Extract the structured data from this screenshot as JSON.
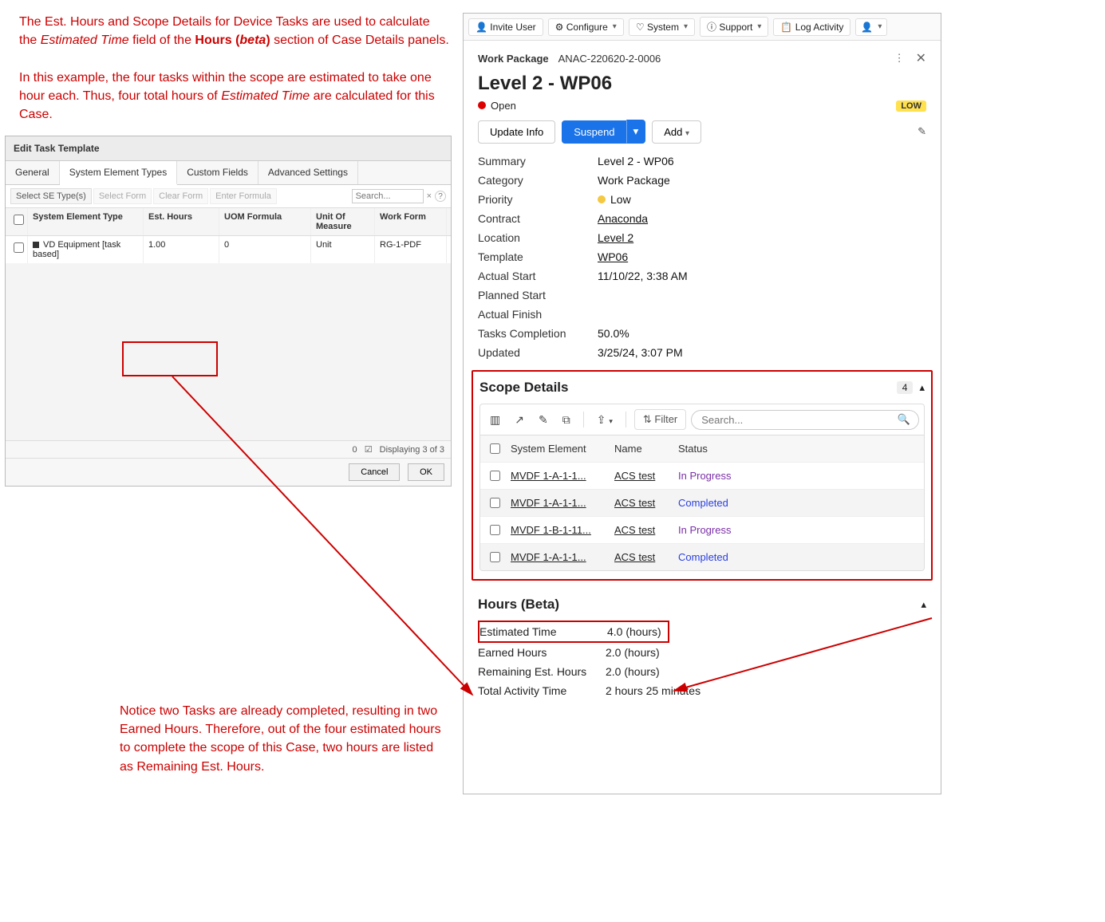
{
  "annotations": {
    "top": "The Est. Hours and Scope Details for Device Tasks are used to calculate the <em>Estimated Time</em> field of the <b>Hours (<em>beta</em>)</b> section of Case Details panels.<br><br>In this example, the four tasks within the scope are estimated to take one hour each. Thus, four total hours of <em>Estimated Time</em> are calculated for this Case.",
    "bottom": "Notice two Tasks are already completed, resulting in two Earned Hours. Therefore, out of the four estimated hours to complete the scope of this Case, two hours are listed as Remaining Est. Hours."
  },
  "editPanel": {
    "title": "Edit Task Template",
    "tabs": [
      "General",
      "System Element Types",
      "Custom Fields",
      "Advanced Settings"
    ],
    "activeTab": 1,
    "toolbar": {
      "select": "Select SE Type(s)",
      "selectForm": "Select Form",
      "clearForm": "Clear Form",
      "enterFormula": "Enter Formula",
      "searchPH": "Search...",
      "clear": "×",
      "help": "?"
    },
    "columns": {
      "set": "System Element Type",
      "est": "Est. Hours",
      "uomf": "UOM Formula",
      "um": "Unit Of Measure",
      "wf": "Work Form"
    },
    "rows": [
      {
        "set": "VD Equipment [task based]",
        "est": "1.00",
        "uomf": "0",
        "um": "Unit",
        "wf": "RG-1-PDF"
      }
    ],
    "footer": {
      "count": "0",
      "check": "☑",
      "display": "Displaying 3 of 3",
      "cancel": "Cancel",
      "ok": "OK"
    }
  },
  "topbar": {
    "invite": "Invite User",
    "configure": "Configure",
    "system": "System",
    "support": "Support",
    "log": "Log Activity"
  },
  "wp": {
    "breadcrumbLabel": "Work Package",
    "breadcrumbId": "ANAC-220620-2-0006",
    "title": "Level 2 - WP06",
    "status": "Open",
    "priorityBadge": "LOW",
    "actions": {
      "update": "Update Info",
      "suspend": "Suspend",
      "add": "Add"
    },
    "fields": [
      {
        "k": "Summary",
        "v": "Level 2 - WP06"
      },
      {
        "k": "Category",
        "v": "Work Package"
      },
      {
        "k": "Priority",
        "v": "Low",
        "dot": true
      },
      {
        "k": "Contract",
        "v": "Anaconda",
        "link": true
      },
      {
        "k": "Location",
        "v": "Level 2",
        "link": true
      },
      {
        "k": "Template",
        "v": "WP06",
        "link": true
      },
      {
        "k": "Actual Start",
        "v": "11/10/22, 3:38 AM"
      },
      {
        "k": "Planned Start",
        "v": ""
      },
      {
        "k": "Actual Finish",
        "v": ""
      },
      {
        "k": "Tasks Completion",
        "v": "50.0%"
      },
      {
        "k": "Updated",
        "v": "3/25/24, 3:07 PM"
      }
    ]
  },
  "scope": {
    "title": "Scope Details",
    "count": "4",
    "filterLabel": "Filter",
    "searchPH": "Search...",
    "columns": {
      "se": "System Element",
      "name": "Name",
      "status": "Status"
    },
    "rows": [
      {
        "se": "MVDF 1-A-1-1...",
        "name": "ACS test",
        "status": "In Progress",
        "cls": "ip"
      },
      {
        "se": "MVDF 1-A-1-1...",
        "name": "ACS test",
        "status": "Completed",
        "cls": "cp",
        "alt": true
      },
      {
        "se": "MVDF 1-B-1-11...",
        "name": "ACS test",
        "status": "In Progress",
        "cls": "ip"
      },
      {
        "se": "MVDF 1-A-1-1...",
        "name": "ACS test",
        "status": "Completed",
        "cls": "cp",
        "alt": true
      }
    ]
  },
  "hours": {
    "title": "Hours (Beta)",
    "rows": [
      {
        "k": "Estimated Time",
        "v": "4.0 (hours)",
        "boxed": true
      },
      {
        "k": "Earned Hours",
        "v": "2.0 (hours)"
      },
      {
        "k": "Remaining Est. Hours",
        "v": "2.0 (hours)"
      },
      {
        "k": "Total Activity Time",
        "v": "2 hours 25 minutes"
      }
    ]
  }
}
